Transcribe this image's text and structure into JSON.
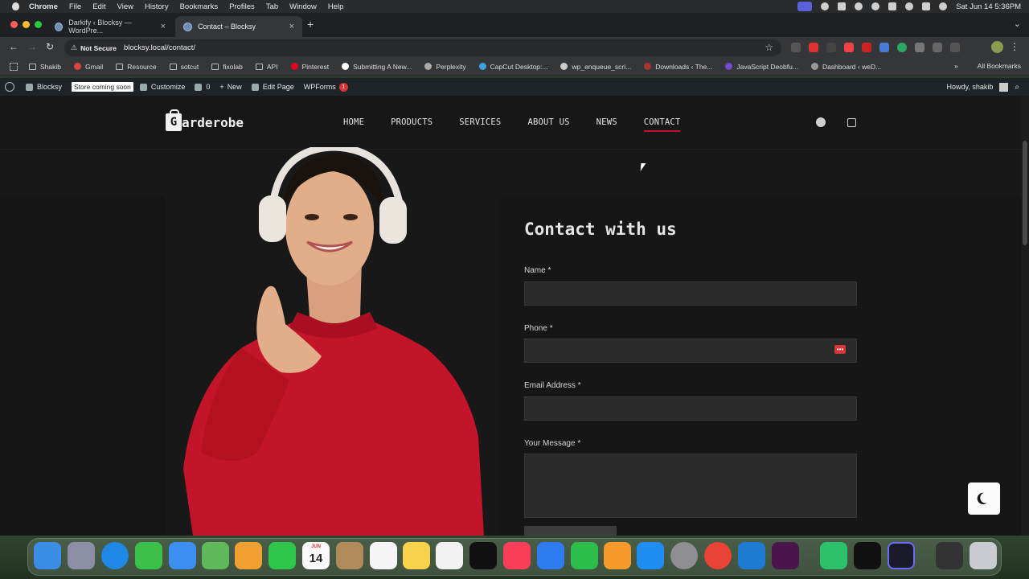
{
  "menubar": {
    "app": "Chrome",
    "items": [
      "File",
      "Edit",
      "View",
      "History",
      "Bookmarks",
      "Profiles",
      "Tab",
      "Window",
      "Help"
    ],
    "datetime": "Sat Jun 14  5:36PM"
  },
  "tabs": [
    {
      "title": "Darkify ‹ Blocksy — WordPre..."
    },
    {
      "title": "Contact – Blocksy"
    }
  ],
  "toolbar": {
    "security_label": "Not Secure",
    "url": "blocksy.local/contact/"
  },
  "bookmarks": {
    "items": [
      "Shakib",
      "Gmail",
      "Resource",
      "sotcut",
      "fixolab",
      "API",
      "Pinterest",
      "Submitting A New...",
      "Perplexity",
      "CapCut Desktop:...",
      "wp_enqueue_scri...",
      "Downloads ‹ The...",
      "JavaScript Deobfu...",
      "Dashboard ‹ weD..."
    ],
    "more": "»",
    "all_bookmarks": "All Bookmarks"
  },
  "wpbar": {
    "site": "Blocksy",
    "store_badge": "Store coming soon",
    "customize": "Customize",
    "comments": "0",
    "new": "New",
    "edit_page": "Edit Page",
    "wpforms": "WPForms",
    "wpforms_count": "1",
    "howdy": "Howdy, shakib"
  },
  "site": {
    "logo_text": "arderobe",
    "logo_letter": "G",
    "nav": [
      "HOME",
      "PRODUCTS",
      "SERVICES",
      "ABOUT US",
      "NEWS",
      "CONTACT"
    ]
  },
  "contact": {
    "title": "Contact with us",
    "name_label": "Name *",
    "phone_label": "Phone *",
    "email_label": "Email Address *",
    "message_label": "Your Message *"
  },
  "dock": {
    "calendar_month": "JUN",
    "calendar_day": "14"
  },
  "colors": {
    "accent": "#c8102e",
    "page_bg": "#181818",
    "sweater": "#c3142a"
  }
}
